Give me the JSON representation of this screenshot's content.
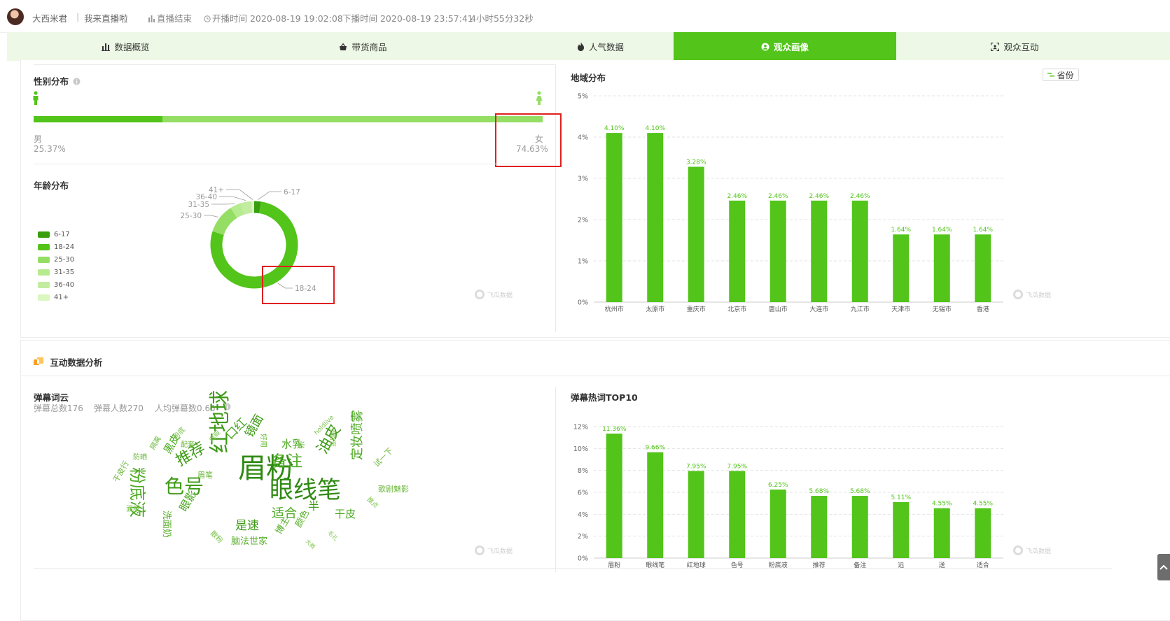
{
  "header": {
    "streamer": "大西米君",
    "separator": "|",
    "title": "我来直播啦",
    "status": "直播结束",
    "start": "开播时间 2020-08-19 19:02:08",
    "end": "下播时间 2020-08-19 23:57:41",
    "duration": "4小时55分32秒"
  },
  "tabs": [
    {
      "label": "数据概览",
      "icon": "bar-chart-icon"
    },
    {
      "label": "带货商品",
      "icon": "shopping-basket-icon"
    },
    {
      "label": "人气数据",
      "icon": "fire-icon"
    },
    {
      "label": "观众画像",
      "icon": "portrait-icon",
      "active": true
    },
    {
      "label": "观众互动",
      "icon": "scan-face-icon"
    }
  ],
  "gender": {
    "title": "性别分布",
    "male_label": "男",
    "male_pct": "25.37%",
    "male_value": 25.37,
    "female_label": "女",
    "female_pct": "74.63%",
    "female_value": 74.63,
    "colors": {
      "male": "#52c41a",
      "female": "#95de64"
    }
  },
  "age": {
    "title": "年龄分布",
    "legend": [
      "6-17",
      "18-24",
      "25-30",
      "31-35",
      "36-40",
      "41+"
    ],
    "callouts": {
      "a": "6-17",
      "b": "18-24",
      "c": "25-30",
      "d": "31-35",
      "e": "36-40",
      "f": "41+"
    }
  },
  "region": {
    "title": "地域分布",
    "toggle": "省份"
  },
  "interaction": {
    "title": "互动数据分析",
    "danmaku_cloud_title": "弹幕词云",
    "total": "弹幕总数176",
    "people": "弹幕人数270",
    "avg": "人均弹幕数0.65",
    "top10_title": "弹幕热词TOP10"
  },
  "wordcloud": [
    {
      "t": "眉粉",
      "s": 40
    },
    {
      "t": "眼线笔",
      "s": 34
    },
    {
      "t": "红地球",
      "s": 30
    },
    {
      "t": "色号",
      "s": 28
    },
    {
      "t": "粉底液",
      "s": 24
    },
    {
      "t": "推荐",
      "s": 22
    },
    {
      "t": "备注",
      "s": 22
    },
    {
      "t": "油皮",
      "s": 22
    },
    {
      "t": "定妆喷雾",
      "s": 18
    },
    {
      "t": "适合",
      "s": 18
    },
    {
      "t": "是速",
      "s": 17
    },
    {
      "t": "眼影",
      "s": 16
    },
    {
      "t": "镜面",
      "s": 17
    },
    {
      "t": "口红",
      "s": 17
    },
    {
      "t": "水乳",
      "s": 15
    },
    {
      "t": "干皮",
      "s": 15
    },
    {
      "t": "黑皮",
      "s": 15
    },
    {
      "t": "洗面奶",
      "s": 13
    },
    {
      "t": "脑法世家",
      "s": 13
    },
    {
      "t": "颜色",
      "s": 13
    },
    {
      "t": "博主",
      "s": 13
    },
    {
      "t": "眉笔",
      "s": 11
    },
    {
      "t": "试一下",
      "s": 11
    },
    {
      "t": "歌剧魅影",
      "s": 11
    },
    {
      "t": "干皮行",
      "s": 11
    },
    {
      "t": "防晒",
      "s": 10
    },
    {
      "t": "隔离",
      "s": 10
    },
    {
      "t": "配套",
      "s": 10
    },
    {
      "t": "好用",
      "s": 10
    },
    {
      "t": "粉底",
      "s": 10
    },
    {
      "t": "面膜",
      "s": 10
    },
    {
      "t": "散粉",
      "s": 10
    },
    {
      "t": "遮瑕",
      "s": 9
    },
    {
      "t": "holdlive",
      "s": 9
    },
    {
      "t": "半",
      "s": 16
    },
    {
      "t": "米",
      "s": 12
    },
    {
      "t": "推点",
      "s": 9
    },
    {
      "t": "大概",
      "s": 8
    },
    {
      "t": "毛孔",
      "s": 8
    },
    {
      "t": "洁面膏",
      "s": 9
    }
  ],
  "watermark": "飞瓜数据",
  "chart_data": [
    {
      "id": "gender",
      "type": "bar",
      "title": "性别分布",
      "categories": [
        "男",
        "女"
      ],
      "values": [
        25.37,
        74.63
      ],
      "unit": "%"
    },
    {
      "id": "age",
      "type": "pie",
      "title": "年龄分布",
      "categories": [
        "6-17",
        "18-24",
        "25-30",
        "31-35",
        "36-40",
        "41+"
      ],
      "values": [
        2.5,
        77.5,
        11,
        4,
        4,
        1
      ],
      "colors": [
        "#389e0d",
        "#52c41a",
        "#95de64",
        "#b7eb8f",
        "#c2eca0",
        "#d9f7be"
      ],
      "legend": "left"
    },
    {
      "id": "region",
      "type": "bar",
      "title": "地域分布",
      "categories": [
        "杭州市",
        "太原市",
        "重庆市",
        "北京市",
        "唐山市",
        "大连市",
        "九江市",
        "天津市",
        "无锡市",
        "香港"
      ],
      "values": [
        4.1,
        4.1,
        3.28,
        2.46,
        2.46,
        2.46,
        2.46,
        1.64,
        1.64,
        1.64
      ],
      "labels": [
        "4.10%",
        "4.10%",
        "3.28%",
        "2.46%",
        "2.46%",
        "2.46%",
        "2.46%",
        "1.64%",
        "1.64%",
        "1.64%"
      ],
      "ylim": [
        0,
        5
      ],
      "yticks": [
        "0%",
        "1%",
        "2%",
        "3%",
        "4%",
        "5%"
      ],
      "grid": true,
      "color": "#52c41a"
    },
    {
      "id": "danmaku_top10",
      "type": "bar",
      "title": "弹幕热词TOP10",
      "categories": [
        "眉粉",
        "眼线笔",
        "红地球",
        "色号",
        "粉底液",
        "推荐",
        "备注",
        "远",
        "送",
        "适合"
      ],
      "values": [
        11.36,
        9.66,
        7.95,
        7.95,
        6.25,
        5.68,
        5.68,
        5.11,
        4.55,
        4.55
      ],
      "labels": [
        "11.36%",
        "9.66%",
        "7.95%",
        "7.95%",
        "6.25%",
        "5.68%",
        "5.68%",
        "5.11%",
        "4.55%",
        "4.55%"
      ],
      "ylim": [
        0,
        12
      ],
      "yticks": [
        "0%",
        "2%",
        "4%",
        "6%",
        "8%",
        "10%",
        "12%"
      ],
      "grid": true,
      "color": "#52c41a"
    }
  ]
}
